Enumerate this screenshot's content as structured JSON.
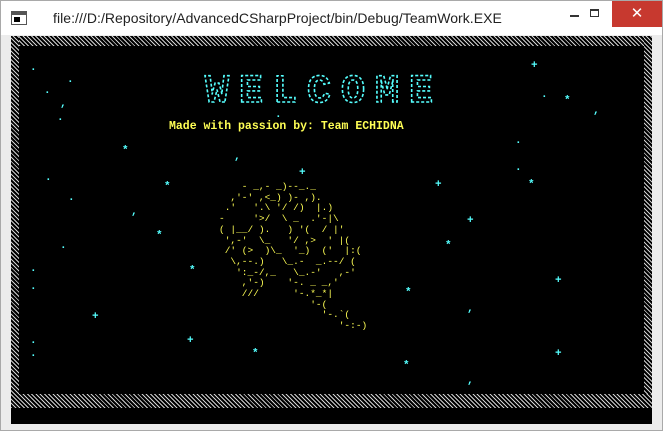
{
  "window": {
    "title": "file:///D:/Repository/AdvancedCSharpProject/bin/Debug/TeamWork.EXE",
    "min_glyph": "",
    "max_glyph": "",
    "close_glyph": "✕"
  },
  "console": {
    "banner": "WELCOME",
    "credit": "Made with passion by: Team ECHIDNA",
    "art": "    - _,- _)--_._\n  ,'-' ,<_) )- ,).\n .'   '.\\ '/ /)  |.)\n-     '>/  \\ _  .'-|\\\n( |__/ ).   ) '(  / |'\n ',-'  \\_   '/ ,>  ' |(\n /' (>  )\\_  '_)  ('  |:(\n  \\,--.)   \\_.-  _.--/ (\n   ':_-/,_   \\_.-'   ,-'\n    ,'-)    '-. _ _,'\n    ///      '-.*_*|\n                '-(\n                  '-.`(\n                     '-:-)",
    "star_char": "*",
    "plus_char": "+",
    "dot_char": ".",
    "comma_char": ","
  },
  "colors": {
    "banner": "#55ffff",
    "credit": "#ffff55",
    "art": "#ffff55",
    "stars": "#55ffff",
    "close_button": "#c7392f"
  }
}
